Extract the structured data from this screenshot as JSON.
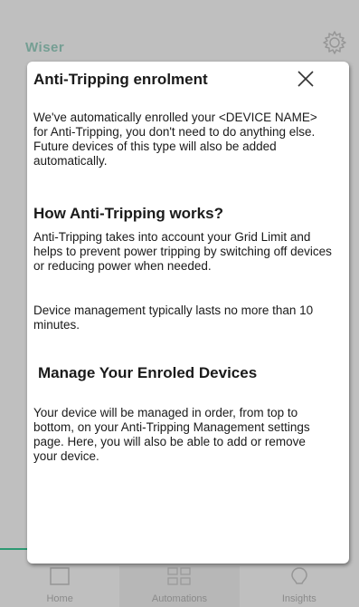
{
  "background": {
    "logo_text": "Wiser",
    "tabs": [
      {
        "label": "Home",
        "icon": "home-icon"
      },
      {
        "label": "Automations",
        "icon": "automations-icon"
      },
      {
        "label": "Insights",
        "icon": "insights-icon"
      }
    ],
    "accent_color": "#3dcd9a"
  },
  "modal": {
    "title": "Anti-Tripping enrolment",
    "intro": "We've automatically enrolled your <DEVICE NAME> for Anti-Tripping, you don't need to do anything else. Future devices of this type will also be added automatically.",
    "how_heading": "How Anti-Tripping works?",
    "how_text": "Anti-Tripping takes into account your Grid Limit and helps to prevent power tripping by switching off devices or reducing power when needed.",
    "duration_text": "Device management typically lasts no more than 10 minutes.",
    "manage_heading": "Manage Your Enroled Devices",
    "manage_text": "Your device will be managed in order, from top to bottom, on your Anti-Tripping Management settings page. Here, you will also be able to add or remove your device.",
    "close_icon": "close-icon"
  }
}
